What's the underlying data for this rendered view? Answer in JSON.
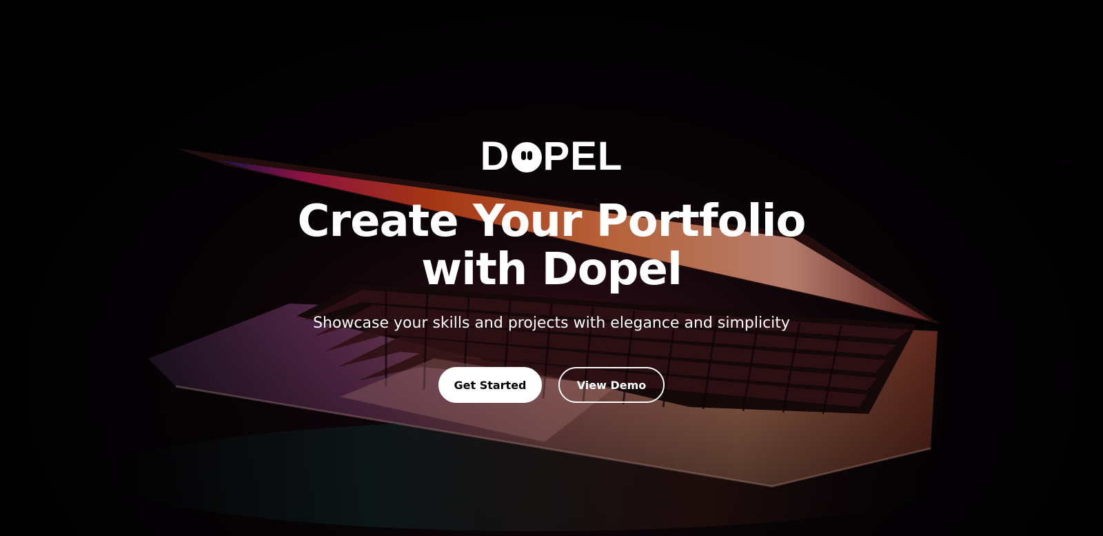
{
  "brand": {
    "logo_text_before": "D",
    "logo_text_after": "PEL",
    "logo_icon": "ghost-eyes-icon"
  },
  "hero": {
    "headline_line1": "Create Your Portfolio",
    "headline_line2": "with Dopel",
    "subtitle": "Showcase your skills and projects with elegance and simplicity",
    "primary_button": "Get Started",
    "secondary_button": "View Demo"
  },
  "colors": {
    "background": "#000000",
    "text": "#ffffff",
    "primary_button_bg": "#ffffff",
    "primary_button_text": "#000000"
  }
}
